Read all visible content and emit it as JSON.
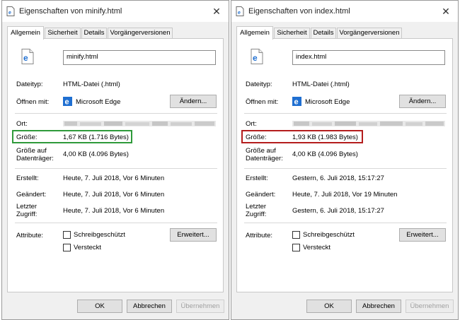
{
  "dialogs": [
    {
      "title": "Eigenschaften von minify.html",
      "tabs": [
        "Allgemein",
        "Sicherheit",
        "Details",
        "Vorgängerversionen"
      ],
      "filename": "minify.html",
      "filetype_label": "Dateityp:",
      "filetype_value": "HTML-Datei (.html)",
      "opens_with_label": "Öffnen mit:",
      "opens_with_value": "Microsoft Edge",
      "change_button": "Ändern...",
      "location_label": "Ort:",
      "size_label": "Größe:",
      "size_value": "1,67 KB (1.716 Bytes)",
      "size_on_disk_label": "Größe auf\nDatenträger:",
      "size_on_disk_value": "4,00 KB (4.096 Bytes)",
      "created_label": "Erstellt:",
      "created_value": "Heute, 7. Juli 2018, Vor 6 Minuten",
      "modified_label": "Geändert:",
      "modified_value": "Heute, 7. Juli 2018, Vor 6 Minuten",
      "accessed_label": "Letzter\nZugriff:",
      "accessed_value": "Heute, 7. Juli 2018, Vor 6 Minuten",
      "attributes_label": "Attribute:",
      "readonly_label": "Schreibgeschützt",
      "hidden_label": "Versteckt",
      "advanced_button": "Erweitert...",
      "ok_button": "OK",
      "cancel_button": "Abbrechen",
      "apply_button": "Übernehmen",
      "highlight_color": "#2f9a3a"
    },
    {
      "title": "Eigenschaften von index.html",
      "tabs": [
        "Allgemein",
        "Sicherheit",
        "Details",
        "Vorgängerversionen"
      ],
      "filename": "index.html",
      "filetype_label": "Dateityp:",
      "filetype_value": "HTML-Datei (.html)",
      "opens_with_label": "Öffnen mit:",
      "opens_with_value": "Microsoft Edge",
      "change_button": "Ändern...",
      "location_label": "Ort:",
      "size_label": "Größe:",
      "size_value": "1,93 KB (1.983 Bytes)",
      "size_on_disk_label": "Größe auf\nDatenträger:",
      "size_on_disk_value": "4,00 KB (4.096 Bytes)",
      "created_label": "Erstellt:",
      "created_value": "Gestern, 6. Juli 2018, 15:17:27",
      "modified_label": "Geändert:",
      "modified_value": "Heute, 7. Juli 2018, Vor 19 Minuten",
      "accessed_label": "Letzter\nZugriff:",
      "accessed_value": "Gestern, 6. Juli 2018, 15:17:27",
      "attributes_label": "Attribute:",
      "readonly_label": "Schreibgeschützt",
      "hidden_label": "Versteckt",
      "advanced_button": "Erweitert...",
      "ok_button": "OK",
      "cancel_button": "Abbrechen",
      "apply_button": "Übernehmen",
      "highlight_color": "#b41d1d"
    }
  ],
  "icons": {
    "title": "file-icon",
    "close": "close-icon",
    "file": "html-file-icon",
    "app": "edge-icon"
  },
  "colors": {
    "edge_blue": "#1f6fd1",
    "green_highlight": "#2f9a3a",
    "red_highlight": "#b41d1d"
  }
}
